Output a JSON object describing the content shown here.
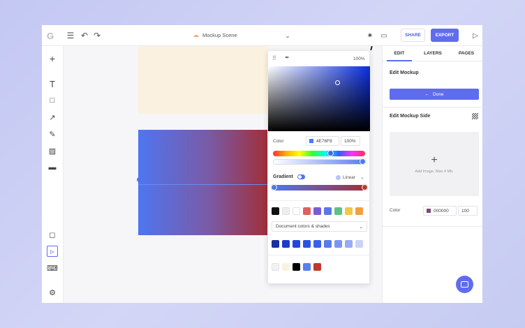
{
  "topbar": {
    "scene_name": "Mockup Scene",
    "share_label": "SHARE",
    "export_label": "EXPORT",
    "icons": [
      "logo-icon",
      "menu-icon",
      "undo-icon",
      "redo-icon",
      "chevron-down-icon",
      "sun-icon",
      "comment-icon",
      "play-icon"
    ]
  },
  "tools": [
    "plus-icon",
    "text-icon",
    "rectangle-icon",
    "arrow-icon",
    "pen-icon",
    "image-icon",
    "table-icon",
    "frame-icon",
    "select-icon",
    "keyboard-icon",
    "settings-icon"
  ],
  "picker": {
    "zoom": "100%",
    "color_label": "Color",
    "hex": "4E76F8",
    "opacity": "100%",
    "gradient_label": "Gradient",
    "gradient_type": "Linear",
    "doc_colors_label": "Document colors & shades",
    "swatches_row1": [
      "#111111",
      "#eeeeee",
      "#ffffff",
      "#e06060",
      "#7b5ad6",
      "#5a78ea",
      "#5cc288",
      "#f2c744",
      "#f0a040"
    ],
    "swatches_row2": [
      "#1a2fa0",
      "#1e3acd",
      "#2346e0",
      "#2a52ea",
      "#3a5ef0",
      "#5a7aee",
      "#7b96f2",
      "#97acf4",
      "#c9d3f8"
    ],
    "swatches_row3": [
      "#f2f2f2",
      "#fbf1e0",
      "#000000",
      "#5a7ef0",
      "#c0392b"
    ]
  },
  "right_panel": {
    "tabs": [
      "EDIT",
      "LAYERS",
      "PAGES"
    ],
    "edit_mockup": "Edit Mockup",
    "done_label": "Done",
    "edit_side": "Edit Mockup Side",
    "add_image": "Add Image. Max 4 Mb.",
    "color_label": "Color",
    "color_hex": "000000",
    "color_opacity": "100"
  },
  "colors": {
    "accent": "#5f6cf0",
    "gradient_start": "#4e76f0",
    "gradient_end": "#a02f3a",
    "mockup_top": "#fbf1e0"
  }
}
